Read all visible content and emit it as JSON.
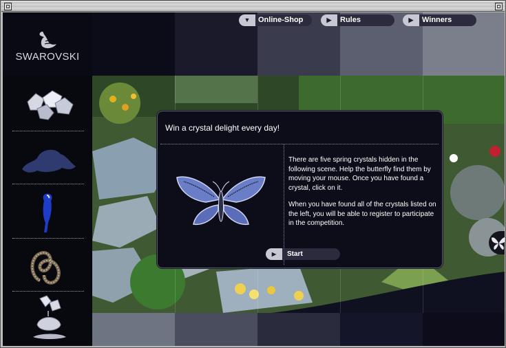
{
  "brand": {
    "name": "SWAROVSKI",
    "logo_icon": "swan-logo-icon"
  },
  "nav": {
    "items": [
      {
        "label": "Online-Shop",
        "icon": "chevron-down-icon"
      },
      {
        "label": "Rules",
        "icon": "play-arrow-icon"
      },
      {
        "label": "Winners",
        "icon": "play-arrow-icon"
      }
    ]
  },
  "sidebar": {
    "crystals": [
      {
        "name": "flowers-crystal-icon"
      },
      {
        "name": "frog-crystal-icon"
      },
      {
        "name": "parrot-crystal-icon"
      },
      {
        "name": "ribbon-crystal-icon"
      },
      {
        "name": "flower-vase-crystal-icon"
      }
    ]
  },
  "dialog": {
    "title": "Win a crystal delight every day!",
    "paragraph1": "There are five spring crystals hidden in the following scene.  Help the butterfly find them by moving your mouse.  Once you have found a crystal, click on it.",
    "paragraph2": "When you have found all of the crystals listed on the left, you will be able to register to participate in the competition.",
    "start_label": "Start",
    "image_icon": "butterfly-crystal-icon"
  },
  "colors": {
    "background": "#0a0a14",
    "button": "#2b2b3d",
    "button_icon_bg": "#c8c8d4",
    "text": "#ffffff"
  }
}
